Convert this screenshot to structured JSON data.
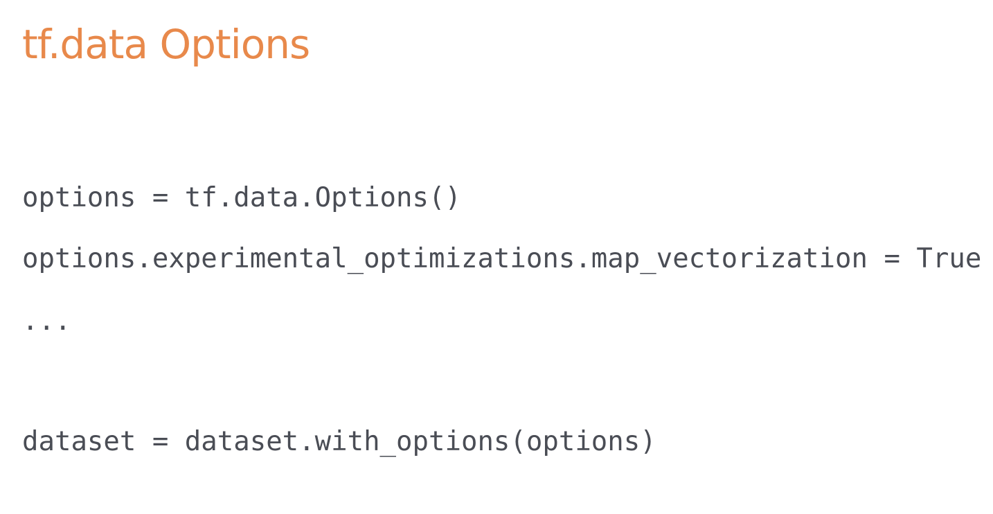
{
  "slide": {
    "title": "tf.data Options",
    "code_lines": [
      "options = tf.data.Options()",
      "options.experimental_optimizations.map_vectorization = True",
      "...",
      "dataset = dataset.with_options(options)"
    ]
  },
  "colors": {
    "title": "#e8894b",
    "code": "#4a4d55",
    "background": "#ffffff"
  }
}
